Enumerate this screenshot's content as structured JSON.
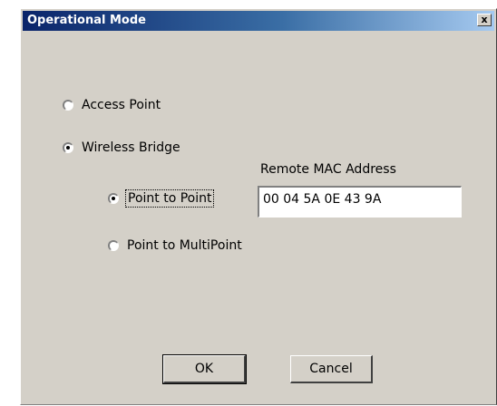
{
  "window": {
    "title": "Operational Mode",
    "close_label": "x"
  },
  "modes": {
    "access_point": {
      "label": "Access Point",
      "checked": false
    },
    "wireless_bridge": {
      "label": "Wireless Bridge",
      "checked": true
    },
    "point_to_point": {
      "label": "Point to Point",
      "checked": true
    },
    "point_to_multipoint": {
      "label": "Point to MultiPoint",
      "checked": false
    }
  },
  "remote_mac": {
    "label": "Remote MAC Address",
    "value": "00 04 5A 0E 43 9A"
  },
  "buttons": {
    "ok": "OK",
    "cancel": "Cancel"
  }
}
